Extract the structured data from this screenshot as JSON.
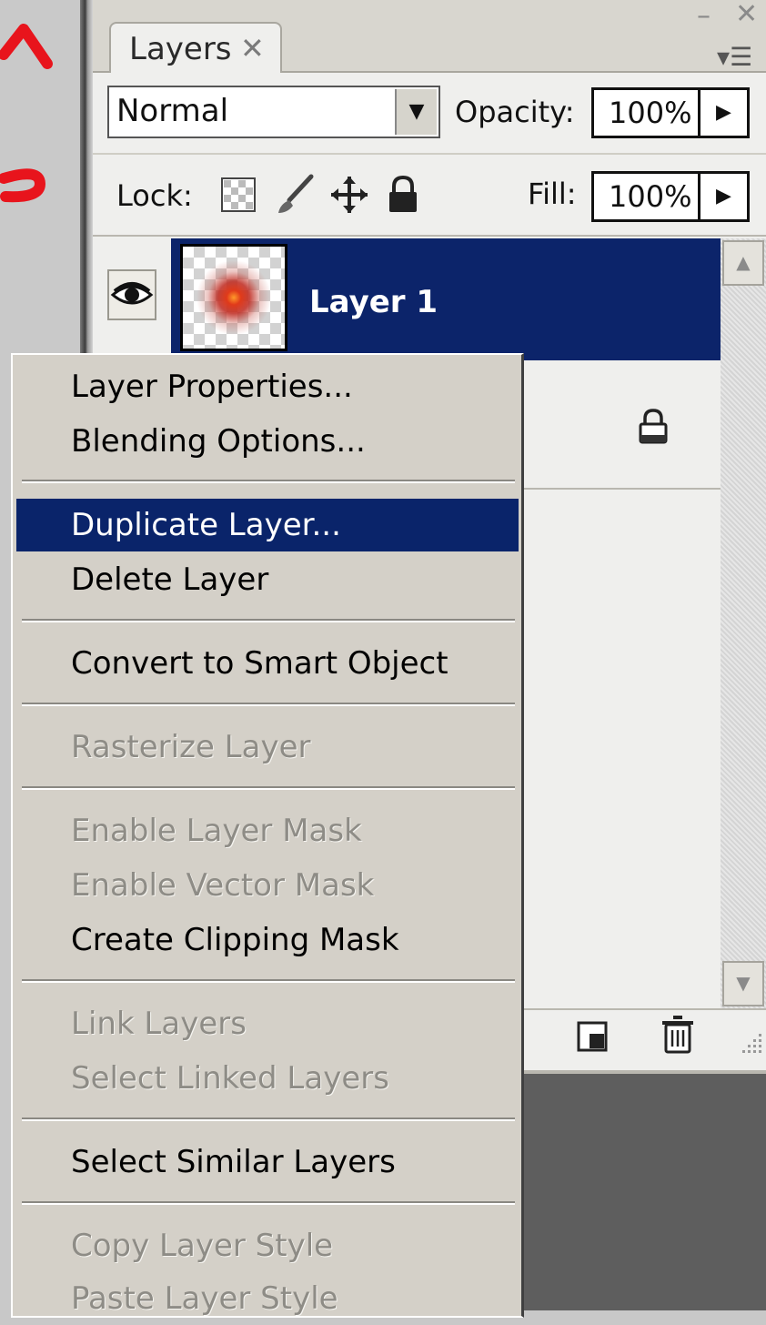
{
  "panel": {
    "tab_label": "Layers",
    "tab_close": "✕",
    "win_min": "–",
    "win_close": "✕",
    "menu_glyph": "▾☰",
    "blend_mode": "Normal",
    "opacity_label": "Opacity:",
    "opacity_value": "100%",
    "lock_label": "Lock:",
    "fill_label": "Fill:",
    "fill_value": "100%",
    "arrow_right": "▶",
    "arrow_down": "▼",
    "scroll_up": "▲",
    "scroll_down": "▼"
  },
  "layers": [
    {
      "name": "Layer 1",
      "selected": true,
      "visible": true
    }
  ],
  "context_menu": {
    "items": [
      {
        "label": "Layer Properties...",
        "enabled": true
      },
      {
        "label": "Blending Options...",
        "enabled": true
      },
      {
        "label": "Duplicate Layer...",
        "enabled": true,
        "highlighted": true
      },
      {
        "label": "Delete Layer",
        "enabled": true
      },
      {
        "label": "Convert to Smart Object",
        "enabled": true
      },
      {
        "label": "Rasterize Layer",
        "enabled": false
      },
      {
        "label": "Enable Layer Mask",
        "enabled": false
      },
      {
        "label": "Enable Vector Mask",
        "enabled": false
      },
      {
        "label": "Create Clipping Mask",
        "enabled": true
      },
      {
        "label": "Link Layers",
        "enabled": false
      },
      {
        "label": "Select Linked Layers",
        "enabled": false
      },
      {
        "label": "Select Similar Layers",
        "enabled": true
      },
      {
        "label": "Copy Layer Style",
        "enabled": false
      },
      {
        "label": "Paste Layer Style",
        "enabled": false
      }
    ]
  },
  "colors": {
    "highlight": "#0a246a",
    "menu_bg": "#d4d0c8",
    "disabled_text": "#8e8c86"
  }
}
